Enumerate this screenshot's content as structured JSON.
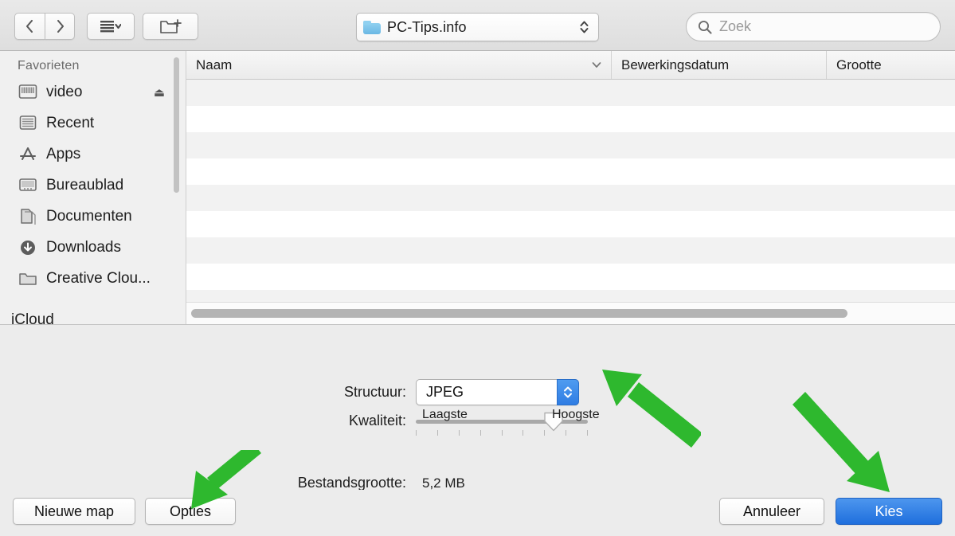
{
  "toolbar": {
    "back_icon": "chevron-left-icon",
    "forward_icon": "chevron-right-icon",
    "view_mode_icon": "list-view-icon",
    "new_folder_icon": "new-folder-icon",
    "path_popup": {
      "label": "PC-Tips.info",
      "icon": "blue-folder-icon"
    },
    "search": {
      "placeholder": "Zoek",
      "value": "",
      "icon": "search-icon"
    }
  },
  "sidebar": {
    "section_title": "Favorieten",
    "items": [
      {
        "label": "video",
        "icon": "drive-icon",
        "eject": "⏏"
      },
      {
        "label": "Recent",
        "icon": "recent-icon",
        "eject": ""
      },
      {
        "label": "Apps",
        "icon": "appstore-icon",
        "eject": ""
      },
      {
        "label": "Bureaublad",
        "icon": "desktop-icon",
        "eject": ""
      },
      {
        "label": "Documenten",
        "icon": "documents-icon",
        "eject": ""
      },
      {
        "label": "Downloads",
        "icon": "downloads-icon",
        "eject": ""
      },
      {
        "label": "Creative Clou...",
        "icon": "folder-icon",
        "eject": ""
      }
    ],
    "next_section_title": "iCloud"
  },
  "file_list": {
    "columns": [
      {
        "label": "Naam",
        "sort_icon": "chevron-down-icon"
      },
      {
        "label": "Bewerkingsdatum"
      },
      {
        "label": "Grootte"
      }
    ],
    "rows": []
  },
  "options": {
    "format_label": "Structuur:",
    "format_value": "JPEG",
    "format_options": [
      "JPEG"
    ],
    "quality_label": "Kwaliteit:",
    "quality_low_label": "Laagste",
    "quality_high_label": "Hoogste",
    "quality_percent": 77,
    "quality_ticks": 9,
    "filesize_label": "Bestandsgrootte:",
    "filesize_value": "5,2 MB"
  },
  "footer": {
    "new_folder_label": "Nieuwe map",
    "options_label": "Opties",
    "cancel_label": "Annuleer",
    "choose_label": "Kies"
  },
  "annotations": {
    "color": "#2eb82e",
    "arrows": [
      {
        "name": "arrow-to-format-popup",
        "points_to": "format_popup"
      },
      {
        "name": "arrow-to-options-button",
        "points_to": "options_button"
      },
      {
        "name": "arrow-to-choose-button",
        "points_to": "choose_button"
      }
    ]
  }
}
